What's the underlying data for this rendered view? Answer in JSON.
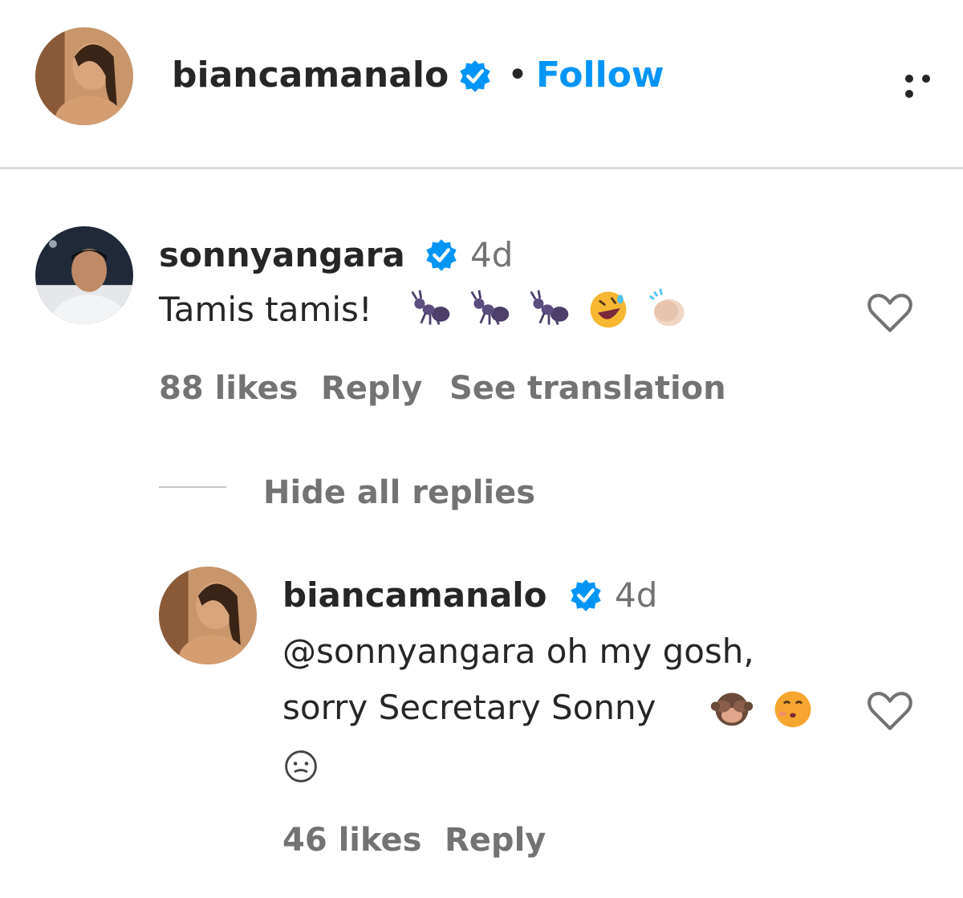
{
  "header": {
    "username": "biancamanalo",
    "separator": "•",
    "follow_label": "Follow"
  },
  "comment": {
    "username": "sonnyangara",
    "time": "4d",
    "text": "Tamis tamis!",
    "emojis": [
      "ant-emoji",
      "ant-emoji",
      "ant-emoji",
      "rolling-laughing-emoji",
      "clapping-hands-emoji"
    ],
    "likes": "88 likes",
    "reply_label": "Reply",
    "translate_label": "See translation"
  },
  "replies_toggle": "Hide all replies",
  "reply": {
    "username": "biancamanalo",
    "time": "4d",
    "text_line1": "@sonnyangara oh my gosh,",
    "text_line2": "sorry Secretary Sonny",
    "emojis": [
      "see-no-evil-monkey-emoji",
      "face-blowing-kiss-emoji",
      "small-face-emoji"
    ],
    "likes": "46 likes",
    "reply_label": "Reply"
  },
  "colors": {
    "accent_blue": "#0095f6",
    "verified_blue": "#0095f6",
    "secondary_text": "#737373",
    "primary_text": "#262626"
  }
}
